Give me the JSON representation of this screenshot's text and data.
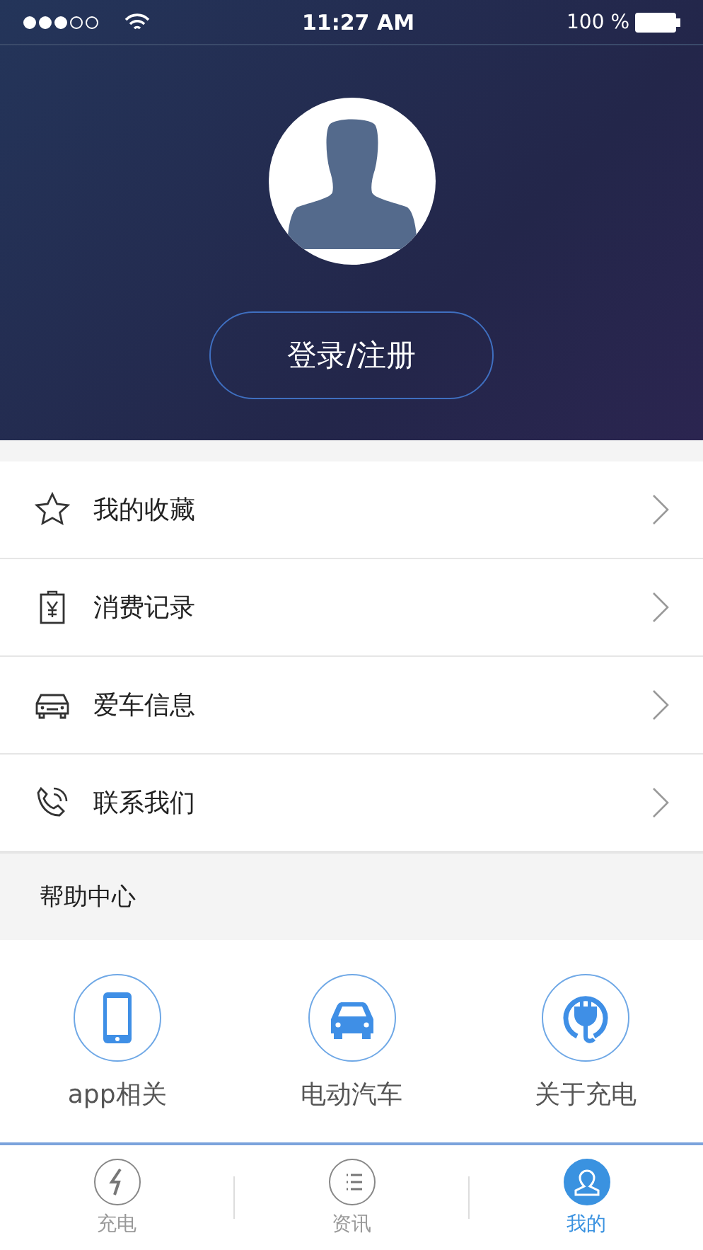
{
  "status_bar": {
    "time": "11:27 AM",
    "battery": "100 %"
  },
  "profile": {
    "login_button": "登录/注册"
  },
  "menu": [
    {
      "kind": "star",
      "label": "我的收藏"
    },
    {
      "kind": "receipt",
      "label": "消费记录"
    },
    {
      "kind": "car",
      "label": "爱车信息"
    },
    {
      "kind": "phone",
      "label": "联系我们"
    }
  ],
  "help_center": {
    "title": "帮助中心",
    "items": [
      {
        "kind": "phone",
        "label": "app相关"
      },
      {
        "kind": "car",
        "label": "电动汽车"
      },
      {
        "kind": "plug",
        "label": "关于充电"
      }
    ]
  },
  "tab_bar": [
    {
      "kind": "bolt",
      "label": "充电",
      "selected": false
    },
    {
      "kind": "list",
      "label": "资讯",
      "selected": false
    },
    {
      "kind": "user",
      "label": "我的",
      "selected": true
    }
  ]
}
